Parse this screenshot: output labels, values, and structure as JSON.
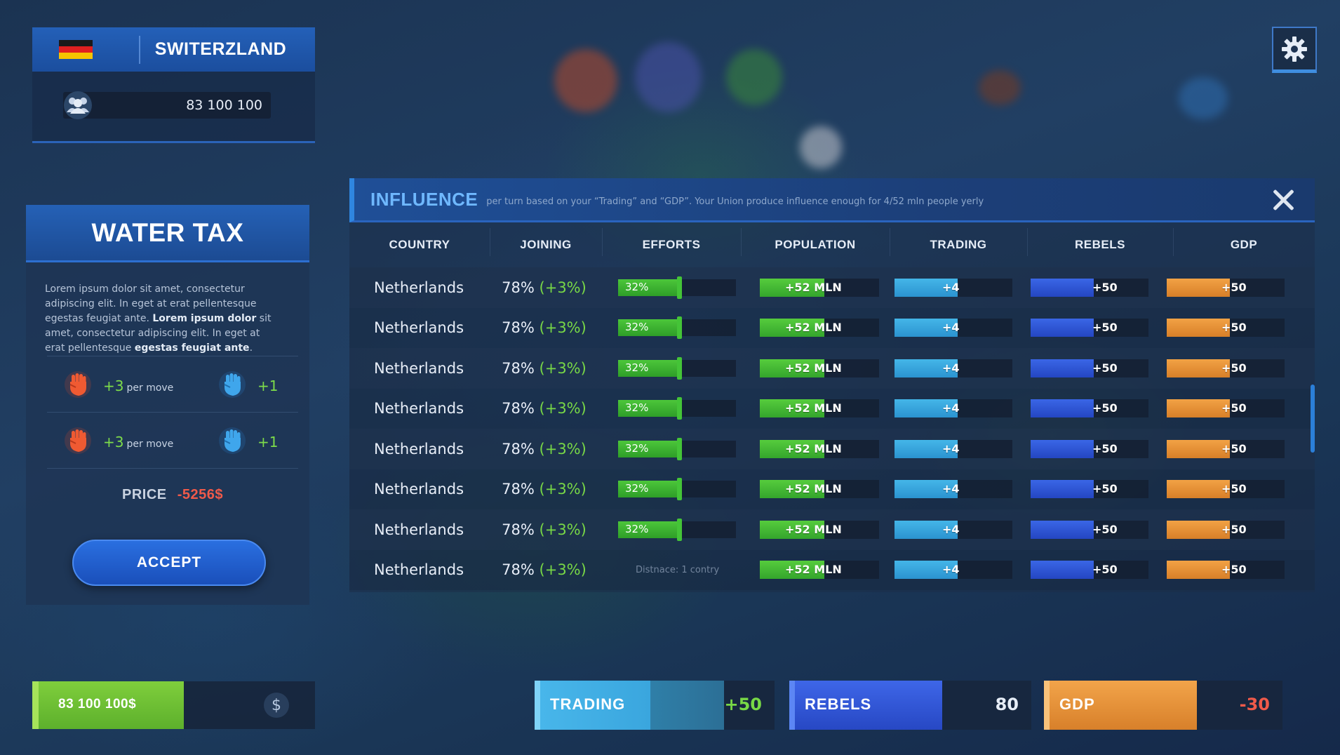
{
  "country_card": {
    "name": "SWITERZLAND",
    "flag_colors": [
      "#1a1a1a",
      "#e02020",
      "#f6c400"
    ],
    "population": "83 100 100",
    "population_icon": "people-icon"
  },
  "policy": {
    "title": "WATER TAX",
    "description_1": "Lorem ipsum dolor sit amet, consectetur adipiscing elit. In eget at erat pellentesque egestas feugiat ante.",
    "description_2_bold": "Lorem ipsum dolor",
    "description_3": " sit amet, consectetur adipiscing elit. In eget at erat pellentesque ",
    "description_4_bold": "egestas feugiat ante",
    "description_5": ".",
    "effects": [
      {
        "red_value": "+3",
        "red_unit": "per move",
        "blue_value": "+1"
      },
      {
        "red_value": "+3",
        "red_unit": "per move",
        "blue_value": "+1"
      }
    ],
    "price_label": "PRICE",
    "price_value": "-5256$",
    "accept_label": "ACCEPT"
  },
  "influence": {
    "title": "INFLUENCE",
    "subtitle": "per turn based on your “Trading” and “GDP”. Your Union produce influence enough for 4/52 mln people yerly",
    "columns": [
      "COUNTRY",
      "JOINING",
      "EFFORTS",
      "POPULATION",
      "TRADING",
      "REBELS",
      "GDP"
    ],
    "rows": [
      {
        "country": "Netherlands",
        "joining": "78%",
        "joining_delta": "(+3%)",
        "efforts": "32%",
        "effort_fraction": 0.52,
        "population": "+52 MLN",
        "trading": "+4",
        "rebels": "+50",
        "gdp": "+50"
      },
      {
        "country": "Netherlands",
        "joining": "78%",
        "joining_delta": "(+3%)",
        "efforts": "32%",
        "effort_fraction": 0.52,
        "population": "+52 MLN",
        "trading": "+4",
        "rebels": "+50",
        "gdp": "+50"
      },
      {
        "country": "Netherlands",
        "joining": "78%",
        "joining_delta": "(+3%)",
        "efforts": "32%",
        "effort_fraction": 0.52,
        "population": "+52 MLN",
        "trading": "+4",
        "rebels": "+50",
        "gdp": "+50"
      },
      {
        "country": "Netherlands",
        "joining": "78%",
        "joining_delta": "(+3%)",
        "efforts": "32%",
        "effort_fraction": 0.52,
        "population": "+52 MLN",
        "trading": "+4",
        "rebels": "+50",
        "gdp": "+50"
      },
      {
        "country": "Netherlands",
        "joining": "78%",
        "joining_delta": "(+3%)",
        "efforts": "32%",
        "effort_fraction": 0.52,
        "population": "+52 MLN",
        "trading": "+4",
        "rebels": "+50",
        "gdp": "+50"
      },
      {
        "country": "Netherlands",
        "joining": "78%",
        "joining_delta": "(+3%)",
        "efforts": "32%",
        "effort_fraction": 0.52,
        "population": "+52 MLN",
        "trading": "+4",
        "rebels": "+50",
        "gdp": "+50"
      },
      {
        "country": "Netherlands",
        "joining": "78%",
        "joining_delta": "(+3%)",
        "efforts": "32%",
        "effort_fraction": 0.52,
        "population": "+52 MLN",
        "trading": "+4",
        "rebels": "+50",
        "gdp": "+50"
      },
      {
        "country": "Netherlands",
        "joining": "78%",
        "joining_delta": "(+3%)",
        "efforts": "",
        "distance": "Distnace: 1 contry",
        "population": "+52 MLN",
        "trading": "+4",
        "rebels": "+50",
        "gdp": "+50"
      }
    ]
  },
  "bottom_bar": {
    "money": "83 100 100$",
    "money_icon": "dollar-icon",
    "trading_label": "TRADING",
    "trading_value": "+50",
    "trading_fraction": 0.65,
    "rebels_label": "REBELS",
    "rebels_value": "80",
    "rebels_fraction": 1.0,
    "gdp_label": "GDP",
    "gdp_value": "-30",
    "gdp_fraction": 1.0
  },
  "colors": {
    "green": "#5db02c",
    "cyan": "#2b93d0",
    "blue": "#2446c2",
    "orange": "#d77f28",
    "negative": "#f05a4a",
    "accent": "#2460b8"
  },
  "settings_icon": "gear-icon"
}
